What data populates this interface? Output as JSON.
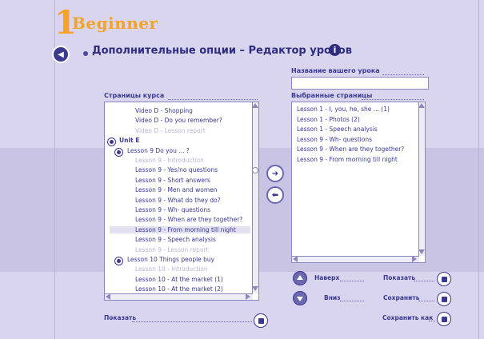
{
  "app": {
    "level_number": "1",
    "level_name": "Beginner"
  },
  "header": {
    "title": "Дополнительные опции – Редактор уроков"
  },
  "labels": {
    "course_pages": "Страницы курса",
    "lesson_name": "Название вашего урока",
    "selected_pages": "Выбранные страницы",
    "show_bottom": "Показать",
    "up": "Наверх",
    "down": "Вниз",
    "show_right": "Показать",
    "save": "Сохранить",
    "save_as": "Сохранить как"
  },
  "lesson_name_input": {
    "value": ""
  },
  "course_pages": [
    {
      "text": "Video D - Shopping",
      "dim": false
    },
    {
      "text": "Video D - Do you remember?",
      "dim": false
    },
    {
      "text": "Video D - Lesson report",
      "dim": true
    },
    {
      "text": "Unit E",
      "dim": false
    },
    {
      "text": "Lesson 9 Do you ... ?",
      "dim": false
    },
    {
      "text": "Lesson 9 - Introduction",
      "dim": true
    },
    {
      "text": "Lesson 9 - Yes/no questions",
      "dim": false
    },
    {
      "text": "Lesson 9 - Short answers",
      "dim": false
    },
    {
      "text": "Lesson 9 - Men and women",
      "dim": false
    },
    {
      "text": "Lesson 9 - What do they do?",
      "dim": false
    },
    {
      "text": "Lesson 9 - Wh- questions",
      "dim": false
    },
    {
      "text": "Lesson 9 - When are they together?",
      "dim": false
    },
    {
      "text": "Lesson 9 - From morning till night",
      "dim": false
    },
    {
      "text": "Lesson 9 - Speech analysis",
      "dim": false
    },
    {
      "text": "Lesson 9 - Lesson report",
      "dim": true
    },
    {
      "text": "Lesson 10 Things people buy",
      "dim": false
    },
    {
      "text": "Lesson 10 - Introduction",
      "dim": true
    },
    {
      "text": "Lesson 10 - At the market (1)",
      "dim": false
    },
    {
      "text": "Lesson 10 - At the market (2)",
      "dim": false
    }
  ],
  "selected_pages": [
    "Lesson 1 - I, you, he, she ... (1)",
    "Lesson 1 - Photos (2)",
    "Lesson 1 - Speech analysis",
    "Lesson 9 - Wh- questions",
    "Lesson 9 - When are they together?",
    "Lesson 9 - From morning till night"
  ],
  "colors": {
    "accent": "#f4a325",
    "primary": "#2e2c80",
    "background": "#d9d5ee"
  }
}
